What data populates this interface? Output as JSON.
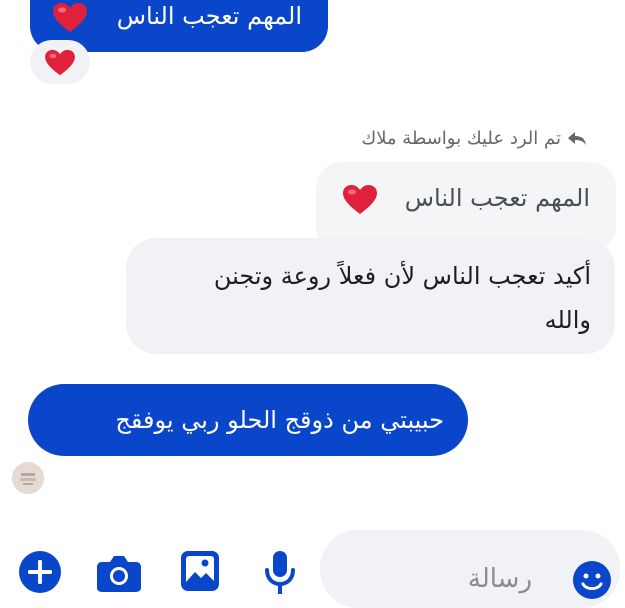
{
  "messages": {
    "top_sent": {
      "text": "المهم تعجب الناس"
    },
    "reaction_emoji": "heart",
    "reply_header": "تم الرد عليك بواسطة ملاك",
    "quoted": {
      "text": "المهم تعجب الناس"
    },
    "received": {
      "line1": "أكيد تعجب الناس لأن فعلاً روعة وتجنن",
      "line2": "والله"
    },
    "sent": {
      "text": "حبيبتي من ذوقج الحلو ربي يوفقج"
    }
  },
  "composer": {
    "placeholder": "رسالة"
  },
  "colors": {
    "sent_bubble": "#0a46c9",
    "received_bubble": "#f1f2f5",
    "quoted_bubble": "#f4f5f7",
    "icon_blue": "#0a46c9",
    "heart_red": "#e0213b"
  },
  "icons": {
    "add": "plus-circle-icon",
    "camera": "camera-icon",
    "gallery": "image-icon",
    "mic": "microphone-icon",
    "emoji": "smiley-icon",
    "reply": "reply-arrow-icon"
  }
}
